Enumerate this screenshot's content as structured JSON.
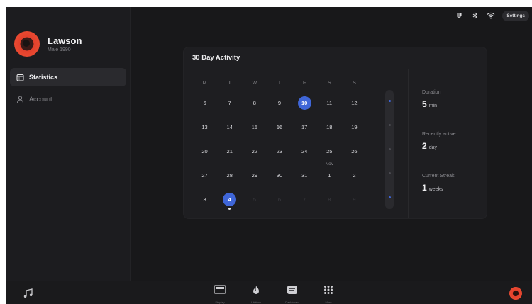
{
  "status_bar": {
    "settings_label": "Settings",
    "icons": [
      "usb-icon",
      "bluetooth-icon",
      "wifi-icon"
    ]
  },
  "profile": {
    "name": "Lawson",
    "meta": "Male 1990"
  },
  "nav": {
    "items": [
      {
        "label": "Statistics",
        "icon": "calendar-icon",
        "active": true
      },
      {
        "label": "Account",
        "icon": "user-icon",
        "active": false
      }
    ]
  },
  "activity": {
    "title": "30 Day Activity",
    "weekdays": [
      "M",
      "T",
      "W",
      "T",
      "F",
      "S",
      "S"
    ],
    "weeks": [
      [
        "6",
        "7",
        "8",
        "9",
        "10",
        "11",
        "12"
      ],
      [
        "13",
        "14",
        "15",
        "16",
        "17",
        "18",
        "19"
      ],
      [
        "20",
        "21",
        "22",
        "23",
        "24",
        "25",
        "26"
      ],
      [
        "27",
        "28",
        "29",
        "30",
        "31",
        "1",
        "2"
      ],
      [
        "3",
        "4",
        "5",
        "6",
        "7",
        "8",
        "9"
      ]
    ],
    "month_marker": "Nov",
    "selected_days": [
      "10",
      "4"
    ],
    "today": "4"
  },
  "stats": {
    "duration": {
      "label": "Duration",
      "value": "5",
      "unit": "min"
    },
    "recent": {
      "label": "Recently active",
      "value": "2",
      "unit": "day"
    },
    "streak": {
      "label": "Current Streak",
      "value": "1",
      "unit": "weeks"
    }
  },
  "dock": {
    "items": [
      {
        "label": "Display",
        "icon": "display-icon"
      },
      {
        "label": "Lifetime",
        "icon": "flame-icon"
      },
      {
        "label": "Dashboard",
        "icon": "dashboard-icon"
      },
      {
        "label": "More",
        "icon": "grid-icon"
      }
    ]
  },
  "colors": {
    "accent": "#3f66d8",
    "brand": "#e2402c",
    "background": "#18181a"
  }
}
